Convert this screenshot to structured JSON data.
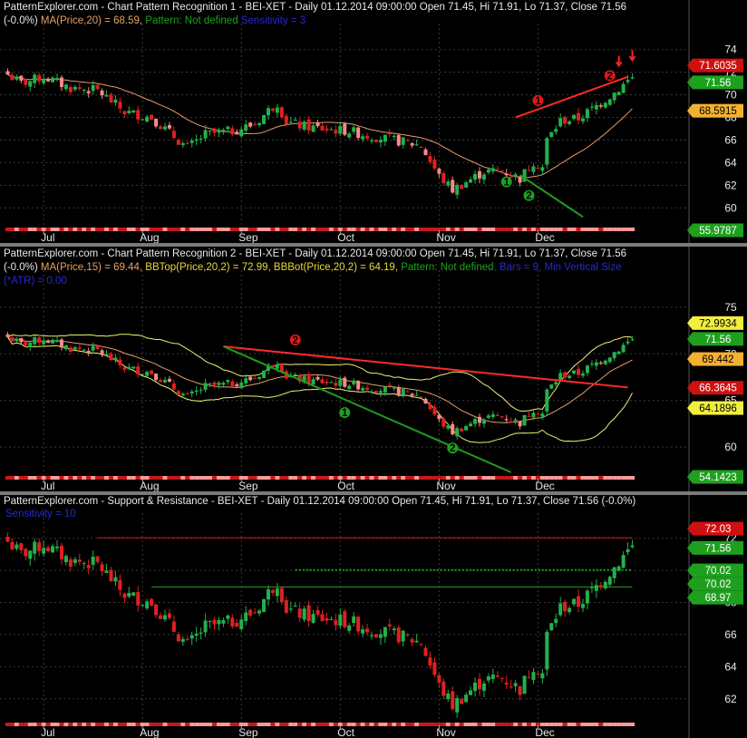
{
  "ohlc_label": "Daily 01.12.2014 09:00:00 Open 71.45, Hi 71.91, Lo 71.37, Close 71.56",
  "x_ticks": [
    "Jul",
    "Aug",
    "Sep",
    "Oct",
    "Nov",
    "Dec"
  ],
  "colors": {
    "up": "#22b14c",
    "down": "#e02020",
    "ma": "#e89a6a",
    "bb": "#f2f070",
    "trend_red": "#ff2a2a",
    "trend_green": "#1f9a1f",
    "sr": "#d01818",
    "sr_green": "#1ea01e",
    "ma_name": "#e8a060",
    "bb_name": "#e8d838",
    "pattern": "#1ea01e",
    "info": "#2828d8"
  },
  "panels": [
    {
      "id": "p1",
      "header_line1_prefix": "PatternExplorer.com - Chart Pattern Recognition 1 - BEI-XET - ",
      "header_line2_change": "(-0.0%)",
      "header_ma": "MA(Price,20) = 68.59,",
      "header_pattern": "Pattern: Not defined",
      "header_info": "Sensitivity = 3",
      "y_ticks": [
        "74",
        "72",
        "70",
        "68",
        "66",
        "64",
        "62",
        "60"
      ],
      "tags": [
        {
          "label": "71.6035",
          "bg": "#d01010",
          "fg": "#ffffff"
        },
        {
          "label": "71.56",
          "bg": "#1ea01e",
          "fg": "#ffffff"
        },
        {
          "label": "68.5915",
          "bg": "#f4b030",
          "fg": "#000000"
        },
        {
          "label": "55.9787",
          "bg": "#1ea01e",
          "fg": "#ffffff"
        }
      ],
      "markers": [
        {
          "label": "1",
          "color": "red"
        },
        {
          "label": "2",
          "color": "red"
        },
        {
          "label": "1",
          "color": "green"
        },
        {
          "label": "2",
          "color": "green"
        }
      ]
    },
    {
      "id": "p2",
      "header_line1_prefix": "PatternExplorer.com - Chart Pattern Recognition 2 - BEI-XET - ",
      "header_line1_suffix": " Close 71.56",
      "header_line2_change": "(-0.0%)",
      "header_ma": "MA(Price,15) = 69.44,",
      "header_bbtop": "BBTop(Price,20,2) = 72.99,",
      "header_bbbot": "BBBot(Price,20,2) = 64.19,",
      "header_pattern": "Pattern: Not defined",
      "header_info": ", Bars = 9, Min Vertical Size",
      "header_info2": "(*ATR) = 0.00",
      "y_ticks": [
        "75",
        "70",
        "65",
        "60"
      ],
      "tags": [
        {
          "label": "72.9934",
          "bg": "#f2ee40",
          "fg": "#000000"
        },
        {
          "label": "71.56",
          "bg": "#1ea01e",
          "fg": "#ffffff"
        },
        {
          "label": "69.442",
          "bg": "#f4b030",
          "fg": "#000000"
        },
        {
          "label": "66.3645",
          "bg": "#d01010",
          "fg": "#ffffff"
        },
        {
          "label": "64.1896",
          "bg": "#f2ee40",
          "fg": "#000000"
        },
        {
          "label": "54.1423",
          "bg": "#1ea01e",
          "fg": "#ffffff"
        }
      ],
      "markers": [
        {
          "label": "2",
          "color": "red"
        },
        {
          "label": "1",
          "color": "green"
        },
        {
          "label": "2",
          "color": "green"
        }
      ]
    },
    {
      "id": "p3",
      "header_line1_prefix": "PatternExplorer.com - Support & Resistance - BEI-XET - ",
      "header_line1_suffix": " (-0.0%)",
      "header_info": "Sensitivity = 10",
      "y_ticks": [
        "72",
        "70",
        "68",
        "66",
        "64",
        "62"
      ],
      "tags": [
        {
          "label": "72.03",
          "bg": "#d01010",
          "fg": "#ffffff"
        },
        {
          "label": "71.56",
          "bg": "#1ea01e",
          "fg": "#ffffff"
        },
        {
          "label": "70.02",
          "bg": "#1ea01e",
          "fg": "#ffffff"
        },
        {
          "label": "70.02",
          "bg": "#1ea01e",
          "fg": "#ffffff"
        },
        {
          "label": "68.97",
          "bg": "#1ea01e",
          "fg": "#ffffff"
        }
      ]
    }
  ],
  "chart_data": [
    {
      "type": "candlestick",
      "title": "Chart Pattern Recognition 1 - BEI-XET - Daily",
      "ylim": [
        58.5,
        75.5
      ],
      "series": [
        {
          "name": "Price",
          "x": [
            "Jul",
            "Aug",
            "Sep",
            "Oct",
            "Nov",
            "Dec"
          ],
          "approx_close": [
            71.6,
            66.5,
            68.5,
            66.0,
            63.5,
            71.56
          ]
        },
        {
          "name": "MA(Price,20)",
          "value": 68.59
        }
      ],
      "trendlines": [
        {
          "color": "red",
          "from": [
            6.95,
            68.0
          ],
          "to": [
            7.0,
            71.6
          ]
        },
        {
          "color": "green",
          "from": [
            6.2,
            63.0
          ],
          "to": [
            6.6,
            56.0
          ]
        }
      ]
    },
    {
      "type": "candlestick",
      "title": "Chart Pattern Recognition 2 - BEI-XET - Daily",
      "ylim": [
        57.0,
        78.0
      ],
      "series": [
        {
          "name": "Price",
          "value": 71.56
        },
        {
          "name": "MA(Price,15)",
          "value": 69.44
        },
        {
          "name": "BBTop(Price,20,2)",
          "value": 72.99
        },
        {
          "name": "BBBot(Price,20,2)",
          "value": 64.19
        }
      ],
      "trendlines": [
        {
          "color": "red",
          "from": [
            9.0,
            70.8
          ],
          "to": [
            12.0,
            66.36
          ]
        },
        {
          "color": "green",
          "from": [
            9.0,
            70.8
          ],
          "to": [
            11.0,
            54.14
          ]
        }
      ]
    },
    {
      "type": "candlestick",
      "title": "Support & Resistance - BEI-XET - Daily",
      "ylim": [
        60.8,
        73.0
      ],
      "series": [
        {
          "name": "Price",
          "value": 71.56
        }
      ],
      "levels": [
        {
          "value": 72.03,
          "color": "red",
          "style": "solid"
        },
        {
          "value": 70.02,
          "color": "green",
          "style": "dotted"
        },
        {
          "value": 68.97,
          "color": "green",
          "style": "solid"
        }
      ]
    }
  ]
}
